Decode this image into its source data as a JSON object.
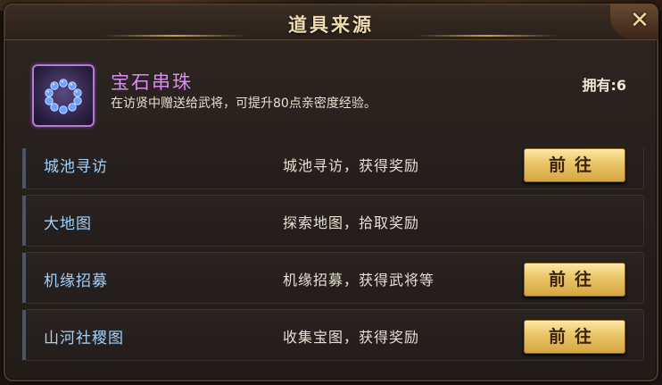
{
  "dialog": {
    "title": "道具来源",
    "close_label": "✕"
  },
  "item": {
    "name": "宝石串珠",
    "description": "在访贤中赠送给武将，可提升80点亲密度经验。",
    "owned": "拥有:6",
    "icon": "blue-gem-bracelet-icon"
  },
  "sources": [
    {
      "name": "城池寻访",
      "description": "城池寻访，获得奖励",
      "button": "前往",
      "has_button": true
    },
    {
      "name": "大地图",
      "description": "探索地图，拾取奖励",
      "button": "",
      "has_button": false
    },
    {
      "name": "机缘招募",
      "description": "机缘招募，获得武将等",
      "button": "前往",
      "has_button": true
    },
    {
      "name": "山河社稷图",
      "description": "收集宝图，获得奖励",
      "button": "前往",
      "has_button": true
    }
  ],
  "colors": {
    "item_name": "#d88cf0",
    "source_name": "#9fd2ff",
    "button_gold": "#e9c566"
  }
}
